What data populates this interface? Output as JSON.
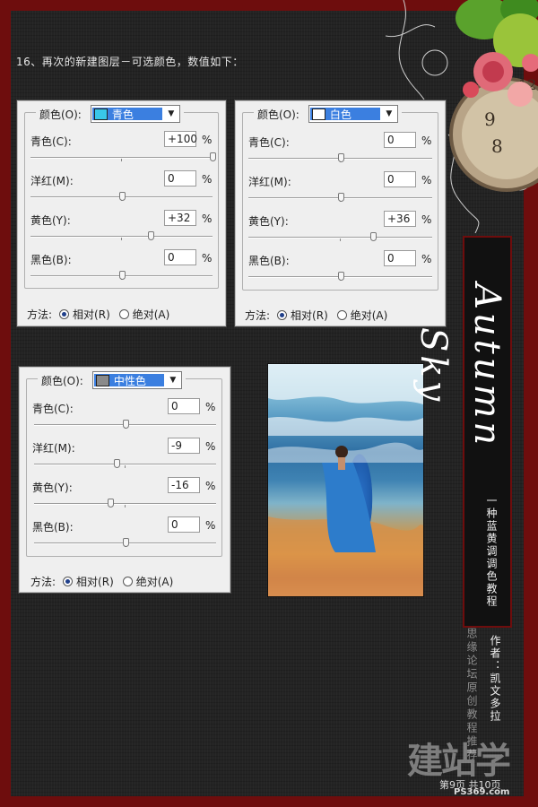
{
  "heading": "16、再次的新建图层－可选颜色，数值如下：",
  "panels": [
    {
      "color_label": "颜色(O):",
      "selected": "青色",
      "swatch": "#39c6e8",
      "rows": [
        {
          "label": "青色(C):",
          "value": "+100",
          "unit": "%",
          "level": 100
        },
        {
          "label": "洋红(M):",
          "value": "0",
          "unit": "%",
          "level": 0
        },
        {
          "label": "黄色(Y):",
          "value": "+32",
          "unit": "%",
          "level": 32
        },
        {
          "label": "黑色(B):",
          "value": "0",
          "unit": "%",
          "level": 0
        }
      ],
      "method_label": "方法:",
      "opt_relative": "相对(R)",
      "opt_absolute": "绝对(A)"
    },
    {
      "color_label": "颜色(O):",
      "selected": "白色",
      "swatch": "#ffffff",
      "rows": [
        {
          "label": "青色(C):",
          "value": "0",
          "unit": "%",
          "level": 0
        },
        {
          "label": "洋红(M):",
          "value": "0",
          "unit": "%",
          "level": 0
        },
        {
          "label": "黄色(Y):",
          "value": "+36",
          "unit": "%",
          "level": 36
        },
        {
          "label": "黑色(B):",
          "value": "0",
          "unit": "%",
          "level": 0
        }
      ],
      "method_label": "方法:",
      "opt_relative": "相对(R)",
      "opt_absolute": "绝对(A)"
    },
    {
      "color_label": "颜色(O):",
      "selected": "中性色",
      "swatch": "#8a8a8a",
      "rows": [
        {
          "label": "青色(C):",
          "value": "0",
          "unit": "%",
          "level": 0
        },
        {
          "label": "洋红(M):",
          "value": "-9",
          "unit": "%",
          "level": -9
        },
        {
          "label": "黄色(Y):",
          "value": "-16",
          "unit": "%",
          "level": -16
        },
        {
          "label": "黑色(B):",
          "value": "0",
          "unit": "%",
          "level": 0
        }
      ],
      "method_label": "方法:",
      "opt_relative": "相对(R)",
      "opt_absolute": "绝对(A)"
    }
  ],
  "side": {
    "title": "Autumn Sky",
    "subtitle": "一种蓝黄调调色教程",
    "author": "作者：凯文多拉",
    "forum": "思缘论坛原创教程推荐",
    "page": "第9页  共10页"
  },
  "watermark": {
    "big": "建站学",
    "small": "PS369.com"
  },
  "colors": {
    "frame": "#6e0d0d",
    "selection": "#3b7fe0"
  }
}
